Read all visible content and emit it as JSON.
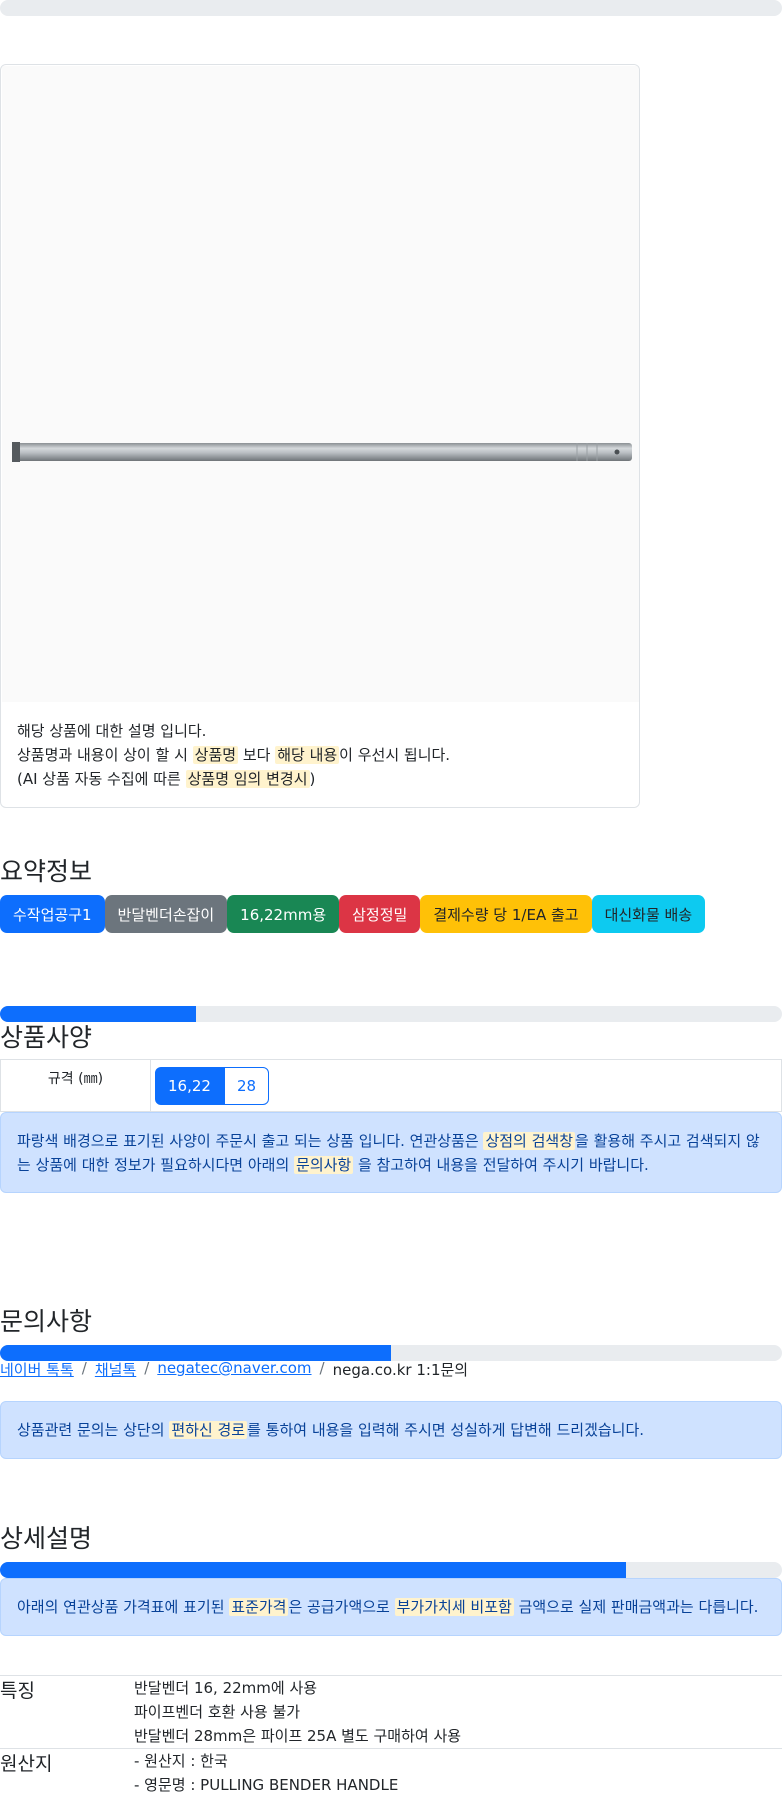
{
  "product": {
    "desc_line1": "해당 상품에 대한 설명 입니다.",
    "desc_line2_a": "상품명과 내용이 상이 할 시 ",
    "desc_line2_hl1": "상품명",
    "desc_line2_b": " 보다 ",
    "desc_line2_hl2": "해당 내용",
    "desc_line2_c": "이 우선시 됩니다.",
    "desc_line3_a": "(AI 상품 자동 수집에 따른 ",
    "desc_line3_hl": "상품명 임의 변경시",
    "desc_line3_b": ")"
  },
  "summary": {
    "title": "요약정보",
    "badges": [
      {
        "label": "수작업공구1",
        "style": "primary"
      },
      {
        "label": "반달벤더손잡이",
        "style": "secondary"
      },
      {
        "label": "16,22mm용",
        "style": "success"
      },
      {
        "label": "삼정정밀",
        "style": "danger"
      },
      {
        "label": "결제수량 당 1/EA 출고",
        "style": "warning"
      },
      {
        "label": "대신화물 배송",
        "style": "info"
      }
    ]
  },
  "spec": {
    "progress": 0.25,
    "title": "상품사양",
    "label": "규격 (㎜)",
    "options": [
      {
        "label": "16,22",
        "selected": true
      },
      {
        "label": "28",
        "selected": false
      }
    ],
    "notice_a": "파랑색 배경으로 표기된 사양이 주문시 출고 되는 상품 입니다. 연관상품은 ",
    "notice_hl1": "상점의 검색창",
    "notice_b": "을 활용해 주시고 검색되지 않는 상품에 대한 정보가 필요하시다면 아래의 ",
    "notice_hl2": "문의사항",
    "notice_c": " 을 참고하여 내용을 전달하여 주시기 바랍니다."
  },
  "inquiry": {
    "title": "문의사항",
    "progress": 0.5,
    "links": {
      "naver": "네이버 톡톡",
      "channel": "채널톡",
      "email": "negatec@naver.com",
      "site": "nega.co.kr 1:1문의",
      "separator": "/"
    },
    "notice_a": "상품관련 문의는 상단의 ",
    "notice_hl": "편하신 경로",
    "notice_b": "를 통하여 내용을 입력해 주시면 성실하게 답변해 드리겠습니다."
  },
  "detail": {
    "title": "상세설명",
    "progress": 0.8,
    "notice_a": "아래의 연관상품 가격표에 표기된 ",
    "notice_hl1": "표준가격",
    "notice_b": "은 공급가액으로 ",
    "notice_hl2": "부가가치세 비포함",
    "notice_c": " 금액으로 실제 판매금액과는 다릅니다.",
    "rows": [
      {
        "label": "특징",
        "lines": [
          "반달벤더 16, 22mm에 사용",
          "파이프벤더 호환 사용 불가",
          "반달벤더 28mm은 파이프 25A 별도 구매하여 사용"
        ]
      },
      {
        "label": "원산지",
        "lines": [
          "- 원산지 : 한국",
          "- 영문명 : PULLING BENDER HANDLE"
        ]
      }
    ]
  }
}
